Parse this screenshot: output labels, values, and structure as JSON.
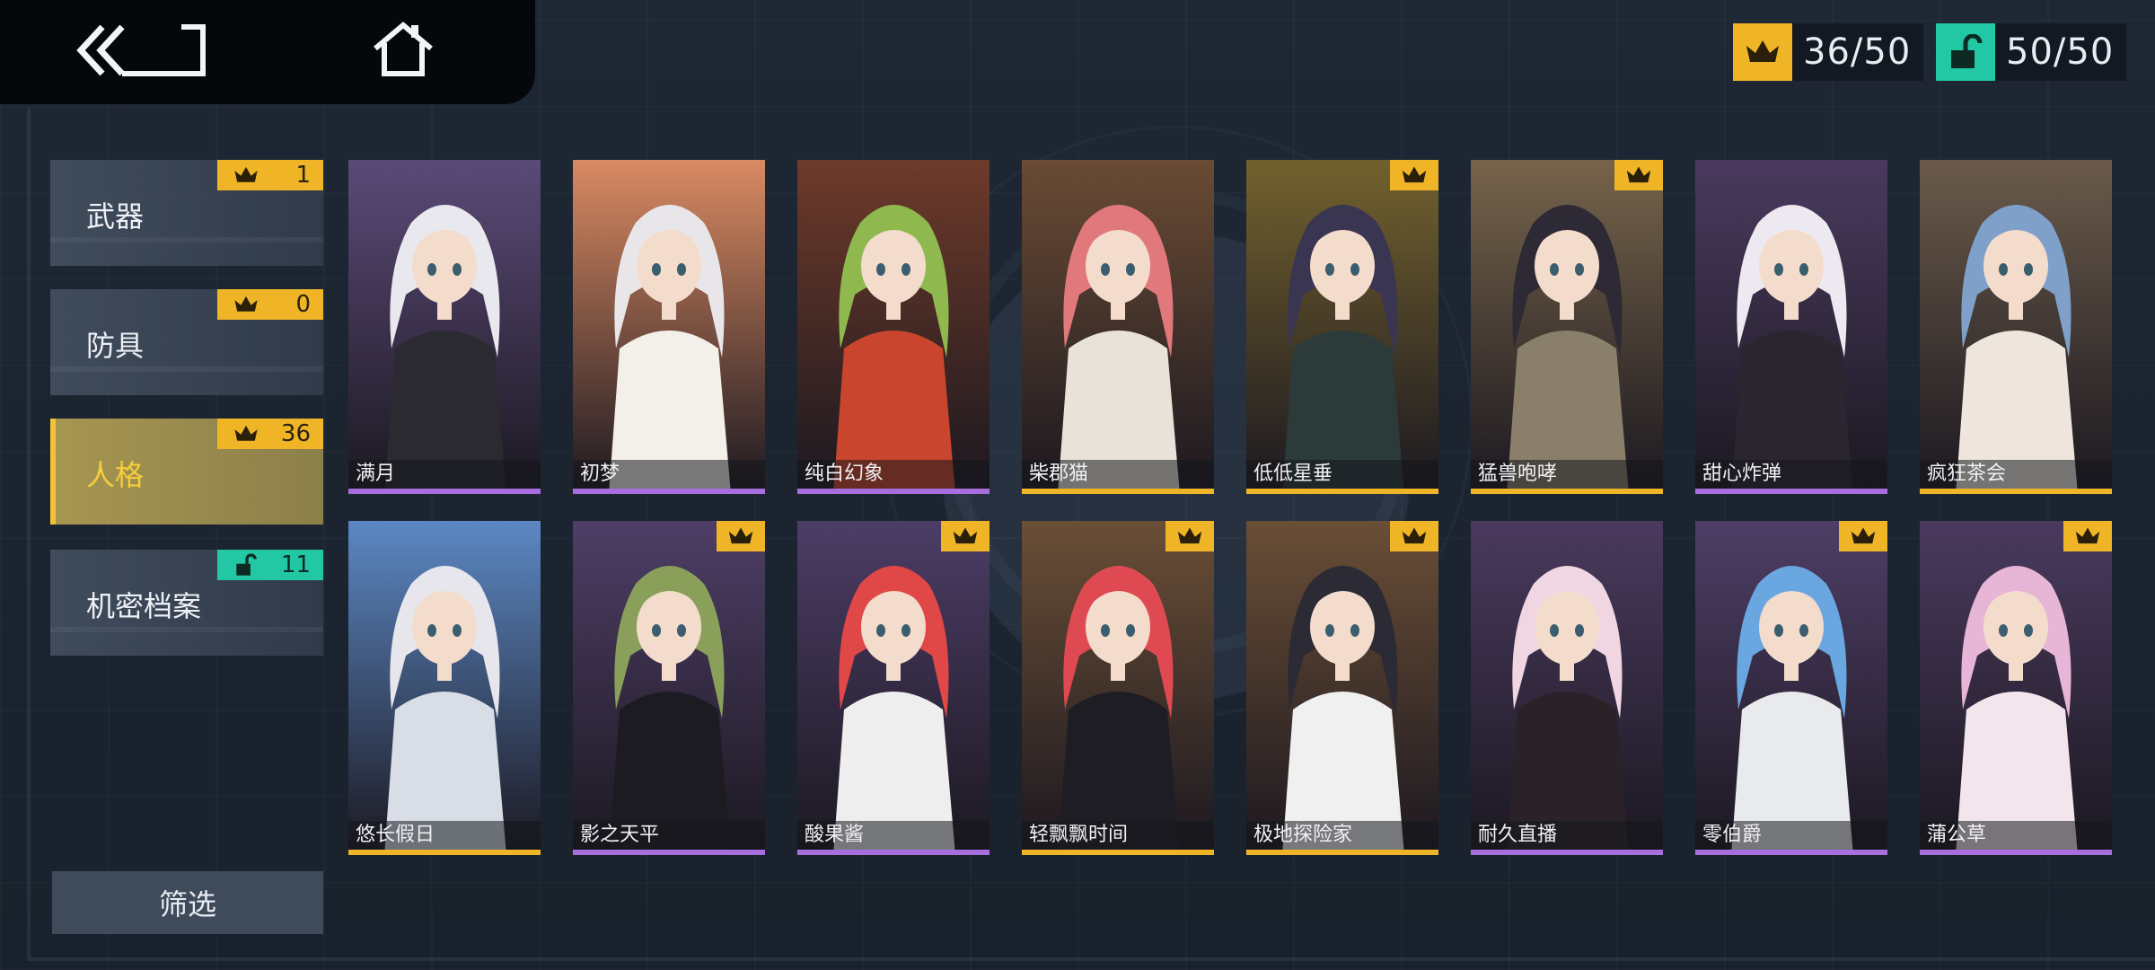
{
  "counters": {
    "crown": "36/50",
    "unlock": "50/50"
  },
  "tabs": [
    {
      "label": "武器",
      "badge": "1",
      "badge_type": "crown",
      "active": false
    },
    {
      "label": "防具",
      "badge": "0",
      "badge_type": "crown",
      "active": false
    },
    {
      "label": "人格",
      "badge": "36",
      "badge_type": "crown",
      "active": true
    },
    {
      "label": "机密档案",
      "badge": "11",
      "badge_type": "unlock",
      "active": false
    }
  ],
  "filter_label": "筛选",
  "cards": [
    {
      "name": "满月",
      "bg": "#5b4a78",
      "hair": "#e8e8ee",
      "outfit": "#2a2a30",
      "crown": false,
      "rarity": "#a86ee0"
    },
    {
      "name": "初梦",
      "bg": "#d98a62",
      "hair": "#e9e6ea",
      "outfit": "#f3efe9",
      "crown": false,
      "rarity": "#a86ee0"
    },
    {
      "name": "纯白幻象",
      "bg": "#6e3a2a",
      "hair": "#8fb94e",
      "outfit": "#c9452e",
      "crown": false,
      "rarity": "#a86ee0"
    },
    {
      "name": "柴郡猫",
      "bg": "#6a4b34",
      "hair": "#e0787c",
      "outfit": "#e9e2d8",
      "crown": false,
      "rarity": "#f0b526"
    },
    {
      "name": "低低星垂",
      "bg": "#72612e",
      "hair": "#3a3550",
      "outfit": "#2c3a3a",
      "crown": true,
      "rarity": "#f0b526"
    },
    {
      "name": "猛兽咆哮",
      "bg": "#76634a",
      "hair": "#2d2a35",
      "outfit": "#8a7f6a",
      "crown": true,
      "rarity": "#f0b526"
    },
    {
      "name": "甜心炸弹",
      "bg": "#4a3a5e",
      "hair": "#eceaf0",
      "outfit": "#2b2530",
      "crown": false,
      "rarity": "#a86ee0"
    },
    {
      "name": "疯狂茶会",
      "bg": "#6a5a4a",
      "hair": "#7fa0c8",
      "outfit": "#eee6dc",
      "crown": false,
      "rarity": "#f0b526"
    },
    {
      "name": "悠长假日",
      "bg": "#5c88c4",
      "hair": "#e6e6ec",
      "outfit": "#d8dde6",
      "crown": false,
      "rarity": "#f0b526"
    },
    {
      "name": "影之天平",
      "bg": "#4e3e66",
      "hair": "#8aa05a",
      "outfit": "#1d1b22",
      "crown": true,
      "rarity": "#a86ee0"
    },
    {
      "name": "酸果酱",
      "bg": "#4c3d66",
      "hair": "#e04848",
      "outfit": "#eeeeee",
      "crown": true,
      "rarity": "#a86ee0"
    },
    {
      "name": "轻飘飘时间",
      "bg": "#6a4e36",
      "hair": "#df4a52",
      "outfit": "#1f1d24",
      "crown": true,
      "rarity": "#f0b526"
    },
    {
      "name": "极地探险家",
      "bg": "#6a4e36",
      "hair": "#2b2a35",
      "outfit": "#f0f0f0",
      "crown": true,
      "rarity": "#f0b526"
    },
    {
      "name": "耐久直播",
      "bg": "#4a3a5e",
      "hair": "#f0d6e2",
      "outfit": "#2a2228",
      "crown": false,
      "rarity": "#a86ee0"
    },
    {
      "name": "零伯爵",
      "bg": "#4e3e66",
      "hair": "#6aa6e0",
      "outfit": "#e8eaee",
      "crown": true,
      "rarity": "#a86ee0"
    },
    {
      "name": "蒲公草",
      "bg": "#4a3a5e",
      "hair": "#e7b6d6",
      "outfit": "#f2e6ec",
      "crown": true,
      "rarity": "#a86ee0"
    }
  ]
}
